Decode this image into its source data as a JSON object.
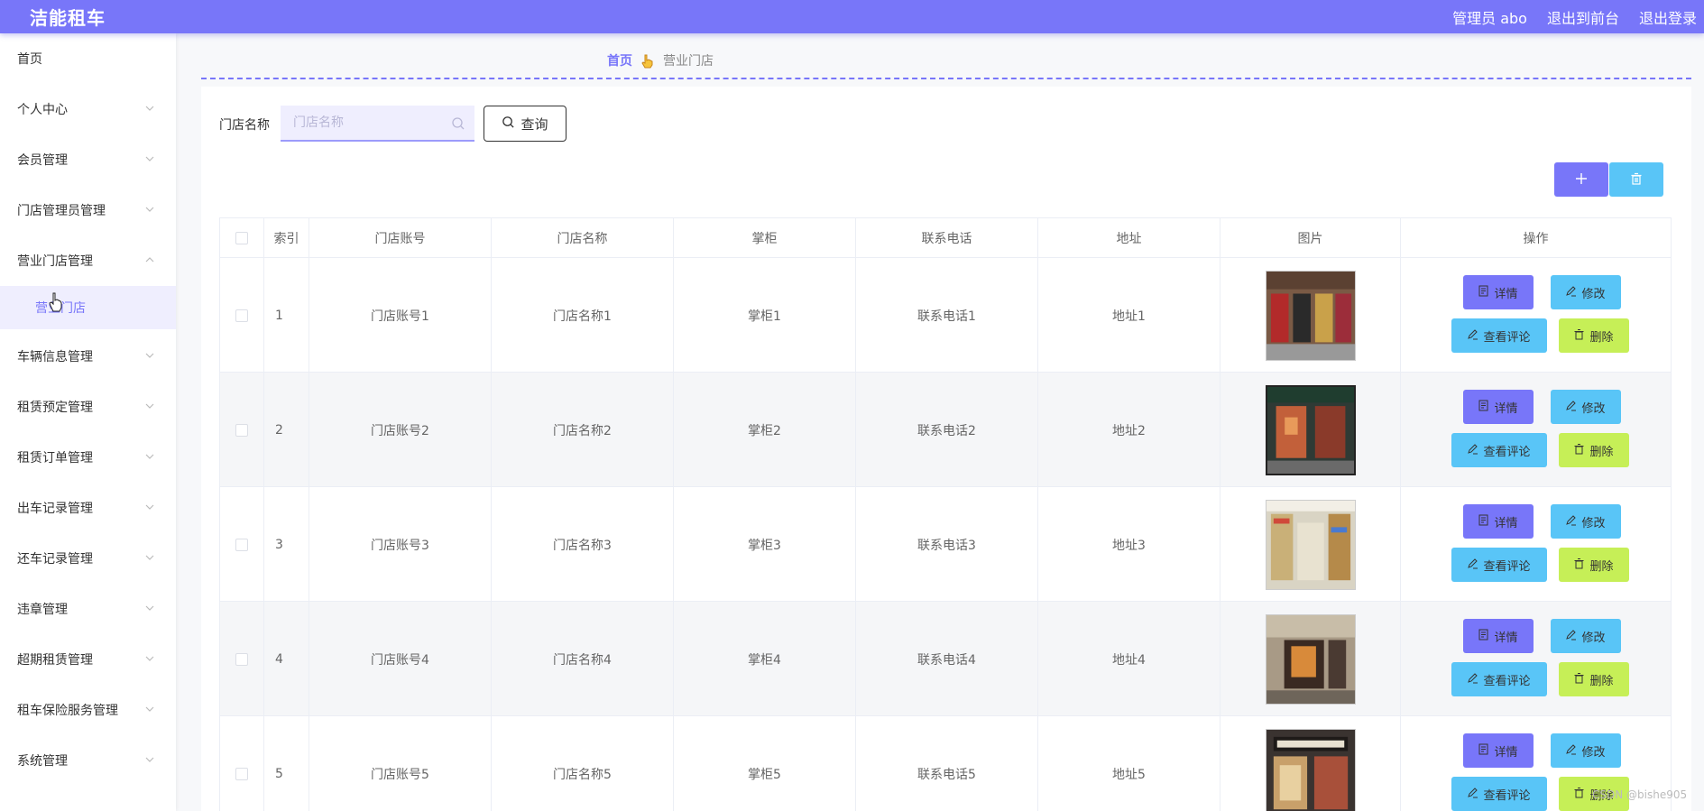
{
  "header": {
    "brand": "洁能租车",
    "admin_label": "管理员 abo",
    "front_label": "退出到前台",
    "logout_label": "退出登录"
  },
  "sidebar": {
    "items": [
      {
        "label": "首页",
        "has_children": false
      },
      {
        "label": "个人中心",
        "has_children": true
      },
      {
        "label": "会员管理",
        "has_children": true
      },
      {
        "label": "门店管理员管理",
        "has_children": true
      },
      {
        "label": "营业门店管理",
        "has_children": true,
        "expanded": true
      },
      {
        "label": "车辆信息管理",
        "has_children": true
      },
      {
        "label": "租赁预定管理",
        "has_children": true
      },
      {
        "label": "租赁订单管理",
        "has_children": true
      },
      {
        "label": "出车记录管理",
        "has_children": true
      },
      {
        "label": "还车记录管理",
        "has_children": true
      },
      {
        "label": "违章管理",
        "has_children": true
      },
      {
        "label": "超期租赁管理",
        "has_children": true
      },
      {
        "label": "租车保险服务管理",
        "has_children": true
      },
      {
        "label": "系统管理",
        "has_children": true
      }
    ],
    "active_sub": "营业门店"
  },
  "breadcrumb": {
    "home": "首页",
    "current": "营业门店"
  },
  "search": {
    "label": "门店名称",
    "placeholder": "门店名称",
    "value": "",
    "query_label": "查询"
  },
  "table": {
    "headers": [
      "索引",
      "门店账号",
      "门店名称",
      "掌柜",
      "联系电话",
      "地址",
      "图片",
      "操作"
    ],
    "rows": [
      {
        "index": "1",
        "account": "门店账号1",
        "name": "门店名称1",
        "manager": "掌柜1",
        "phone": "联系电话1",
        "address": "地址1"
      },
      {
        "index": "2",
        "account": "门店账号2",
        "name": "门店名称2",
        "manager": "掌柜2",
        "phone": "联系电话2",
        "address": "地址2"
      },
      {
        "index": "3",
        "account": "门店账号3",
        "name": "门店名称3",
        "manager": "掌柜3",
        "phone": "联系电话3",
        "address": "地址3"
      },
      {
        "index": "4",
        "account": "门店账号4",
        "name": "门店名称4",
        "manager": "掌柜4",
        "phone": "联系电话4",
        "address": "地址4"
      },
      {
        "index": "5",
        "account": "门店账号5",
        "name": "门店名称5",
        "manager": "掌柜5",
        "phone": "联系电话5",
        "address": "地址5"
      }
    ],
    "actions": {
      "detail": "详情",
      "edit": "修改",
      "review": "查看评论",
      "delete": "删除"
    }
  },
  "watermark": "CSDN @bishe905",
  "colors": {
    "primary": "#7876f9",
    "info": "#59c5f7",
    "lime": "#c6ef57"
  }
}
